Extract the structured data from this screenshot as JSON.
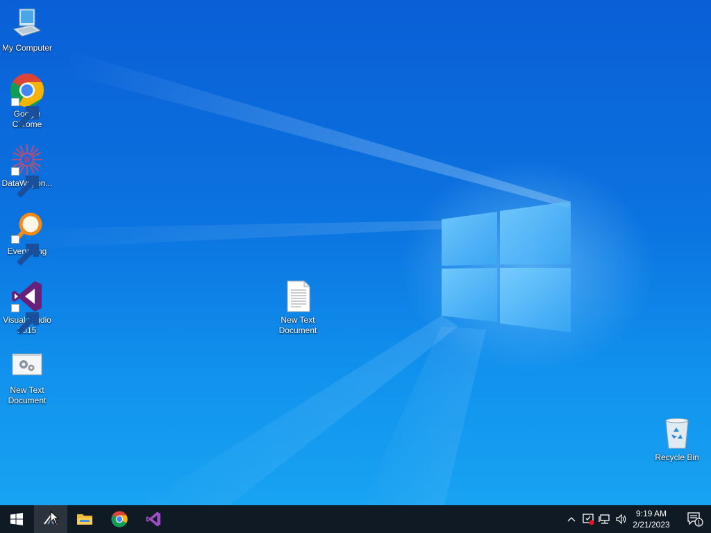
{
  "desktop": {
    "icons": [
      {
        "label": "My Computer",
        "icon": "computer-icon"
      },
      {
        "label": "Google\nChrome",
        "icon": "chrome-icon"
      },
      {
        "label": "DataWagon...",
        "icon": "datawagon-icon"
      },
      {
        "label": "Everything",
        "icon": "everything-search-icon"
      },
      {
        "label": "Visual Studio\n2015",
        "icon": "visual-studio-icon"
      },
      {
        "label": "New Text\nDocument",
        "icon": "settings-file-icon"
      },
      {
        "label": "New Text\nDocument",
        "icon": "text-document-icon"
      },
      {
        "label": "Recycle Bin",
        "icon": "recycle-bin-icon"
      }
    ],
    "wallpaper": {
      "logo": "windows-logo",
      "color_top": "#0a5fd6",
      "color_bottom": "#18a3f2"
    }
  },
  "taskbar": {
    "pinned": [
      {
        "name": "start-button",
        "icon": "windows-start-icon"
      },
      {
        "name": "active-app",
        "icon": "app-icon",
        "active": true
      },
      {
        "name": "file-explorer",
        "icon": "folder-icon"
      },
      {
        "name": "google-chrome",
        "icon": "chrome-icon"
      },
      {
        "name": "visual-studio",
        "icon": "visual-studio-icon"
      }
    ],
    "tray": {
      "icons": [
        "chevron-up-icon",
        "security-alert-icon",
        "network-icon",
        "volume-icon"
      ],
      "time": "9:19 AM",
      "date": "2/21/2023",
      "notification_count": "1"
    },
    "background": "#101a24"
  }
}
